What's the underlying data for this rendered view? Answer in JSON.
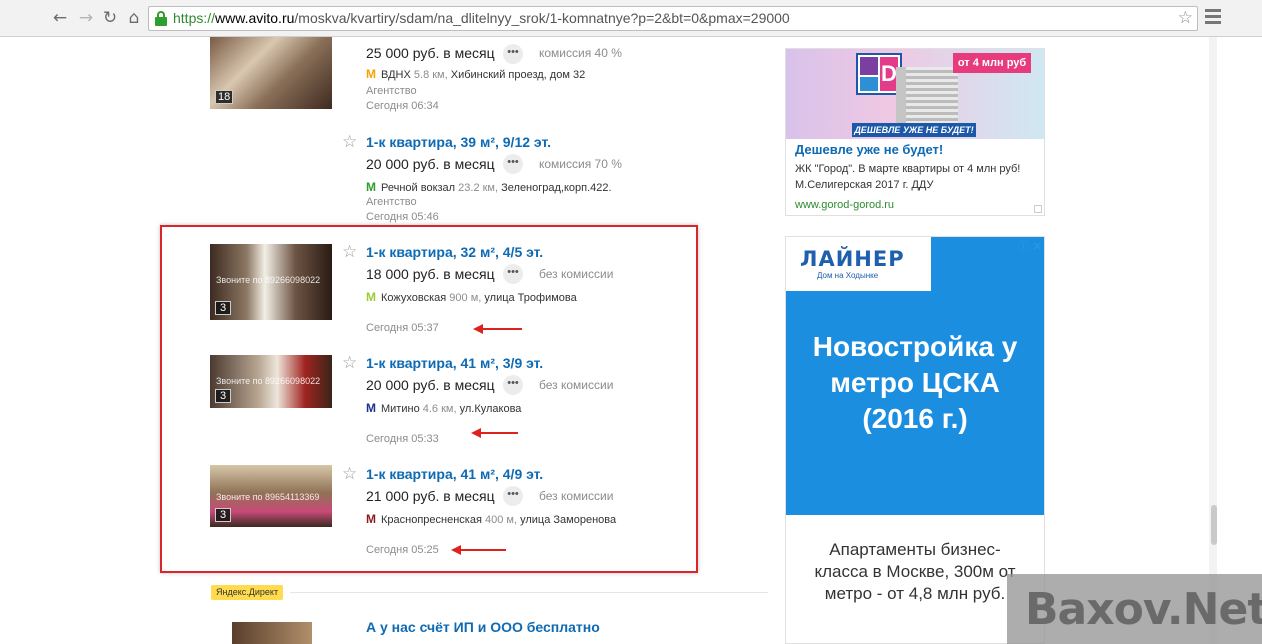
{
  "browser": {
    "url_scheme": "https://",
    "url_host": "www.avito.ru",
    "url_path": "/moskva/kvartiry/sdam/na_dlitelnyy_srok/1-komnatnye?p=2&bt=0&pmax=29000",
    "nav_icons": [
      "back-arrow-icon",
      "forward-arrow-icon",
      "reload-icon",
      "home-icon",
      "lock-icon",
      "bookmark-star-icon",
      "menu-icon"
    ]
  },
  "listings": [
    {
      "title": "",
      "price": "25 000 руб. в месяц",
      "commission": "комиссия 40 %",
      "metro_color": "#f5a300",
      "metro": "ВДНХ",
      "distance": "5.8 км,",
      "address": "Хибинский проезд, дом 32",
      "agency": "Агентство",
      "date": "Сегодня 06:34",
      "photos": "18",
      "watermark": ""
    },
    {
      "title": "1-к квартира, 39 м², 9/12 эт.",
      "price": "20 000 руб. в месяц",
      "commission": "комиссия 70 %",
      "metro_color": "#2e9e2e",
      "metro": "Речной вокзал",
      "distance": "23.2 км,",
      "address": "Зеленоград,корп.422.",
      "agency": "Агентство",
      "date": "Сегодня 05:46",
      "photos": "",
      "watermark": ""
    },
    {
      "title": "1-к квартира, 32 м², 4/5 эт.",
      "price": "18 000 руб. в месяц",
      "commission": "без комиссии",
      "metro_color": "#9acd32",
      "metro": "Кожуховская",
      "distance": "900 м,",
      "address": "улица Трофимова",
      "agency": "",
      "date": "Сегодня 05:37",
      "photos": "3",
      "watermark": "Звоните по 89266098022"
    },
    {
      "title": "1-к квартира, 41 м², 3/9 эт.",
      "price": "20 000 руб. в месяц",
      "commission": "без комиссии",
      "metro_color": "#1d2f8f",
      "metro": "Митино",
      "distance": "4.6 км,",
      "address": "ул.Кулакова",
      "agency": "",
      "date": "Сегодня 05:33",
      "photos": "3",
      "watermark": "Звоните по 89266098022"
    },
    {
      "title": "1-к квартира, 41 м², 4/9 эт.",
      "price": "21 000 руб. в месяц",
      "commission": "без комиссии",
      "metro_color": "#8b1a1a",
      "metro": "Краснопресненская",
      "distance": "400 м,",
      "address": "улица Заморенова",
      "agency": "",
      "date": "Сегодня 05:25",
      "photos": "3",
      "watermark": "Звоните по 89654113369"
    }
  ],
  "yandex_direct": {
    "label": "Яндекс.Директ",
    "title": "А у нас счёт ИП и ООО бесплатно"
  },
  "ad1": {
    "logo_letters": "D",
    "price_tag": "от 4 млн руб",
    "ribbon": "ДЕШЕВЛЕ УЖЕ НЕ БУДЕТ!",
    "title": "Дешевле уже не будет!",
    "text": "ЖК \"Город\". В марте квартиры от 4 млн руб! М.Селигерская 2017 г. ДДУ",
    "url": "www.gorod-gorod.ru"
  },
  "ad2": {
    "logo": "ЛАЙНЕР",
    "logo_sub": "Дом на Ходынке",
    "headline": "Новостройка у метро ЦСКА (2016 г.)",
    "text": "Апартаменты бизнес-класса в Москве, 300м от метро - от 4,8 млн руб.",
    "corner_icons": "ⓘ ✕"
  },
  "watermark": "Baxov.Net"
}
